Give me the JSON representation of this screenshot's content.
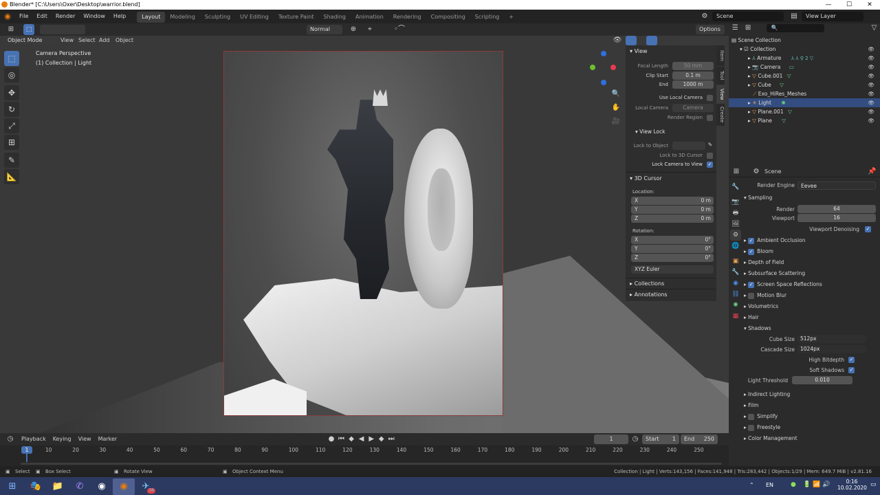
{
  "window": {
    "title": "Blender* [C:\\Users\\Oxer\\Desktop\\warrior.blend]",
    "minimize": "—",
    "maximize": "☐",
    "close": "✕"
  },
  "menubar": {
    "items": [
      "File",
      "Edit",
      "Render",
      "Window",
      "Help"
    ],
    "workspaces": [
      "Layout",
      "Modeling",
      "Sculpting",
      "UV Editing",
      "Texture Paint",
      "Shading",
      "Animation",
      "Rendering",
      "Compositing",
      "Scripting"
    ],
    "active_workspace": "Layout",
    "add_tab": "+",
    "scene": "Scene",
    "view_layer": "View Layer"
  },
  "toolheader": {
    "orientation": "Normal",
    "options": "Options"
  },
  "viewport_header": {
    "mode": "Object Mode",
    "menus": [
      "View",
      "Select",
      "Add",
      "Object"
    ]
  },
  "overlay": {
    "line1": "Camera Perspective",
    "line2": "(1) Collection | Light"
  },
  "npanel": {
    "tabs": [
      "Item",
      "Tool",
      "View",
      "Create"
    ],
    "view_header": "View",
    "focal_length_label": "Focal Length",
    "focal_length": "50 mm",
    "clip_start_label": "Clip Start",
    "clip_start": "0.1 m",
    "end_label": "End",
    "end": "1000 m",
    "use_local_camera": "Use Local Camera",
    "local_camera_label": "Local Camera",
    "local_camera": "Camera",
    "render_region": "Render Region",
    "view_lock_header": "View Lock",
    "lock_to_object": "Lock to Object",
    "lock_3d_cursor": "Lock to 3D Cursor",
    "lock_camera_to_view": "Lock Camera to View",
    "cursor_header": "3D Cursor",
    "location_label": "Location:",
    "loc": [
      {
        "axis": "X",
        "value": "0 m"
      },
      {
        "axis": "Y",
        "value": "0 m"
      },
      {
        "axis": "Z",
        "value": "0 m"
      }
    ],
    "rotation_label": "Rotation:",
    "rot": [
      {
        "axis": "X",
        "value": "0°"
      },
      {
        "axis": "Y",
        "value": "0°"
      },
      {
        "axis": "Z",
        "value": "0°"
      }
    ],
    "rot_mode": "XYZ Euler",
    "collections": "Collections",
    "annotations": "Annotations"
  },
  "outliner": {
    "root": "Scene Collection",
    "collection": "Collection",
    "items": [
      "Armature",
      "Camera",
      "Cube.001",
      "Cube",
      "Exo_HiRes_Meshes",
      "Light",
      "Plane.001",
      "Plane"
    ],
    "selected": "Light",
    "armature_count": "2"
  },
  "properties": {
    "context": "Scene",
    "render_engine_label": "Render Engine",
    "render_engine": "Eevee",
    "sampling": "Sampling",
    "render_label": "Render",
    "render_samples": "64",
    "viewport_label": "Viewport",
    "viewport_samples": "16",
    "viewport_denoising": "Viewport Denoising",
    "panels": [
      {
        "label": "Ambient Occlusion",
        "check": true
      },
      {
        "label": "Bloom",
        "check": true
      },
      {
        "label": "Depth of Field",
        "check": null
      },
      {
        "label": "Subsurface Scattering",
        "check": null
      },
      {
        "label": "Screen Space Reflections",
        "check": true
      },
      {
        "label": "Motion Blur",
        "check": false
      },
      {
        "label": "Volumetrics",
        "check": null
      },
      {
        "label": "Hair",
        "check": null
      }
    ],
    "shadows": "Shadows",
    "cube_size_label": "Cube Size",
    "cube_size": "512px",
    "cascade_size_label": "Cascade Size",
    "cascade_size": "1024px",
    "high_bitdepth": "High Bitdepth",
    "soft_shadows": "Soft Shadows",
    "light_threshold_label": "Light Threshold",
    "light_threshold": "0.010",
    "panels2": [
      {
        "label": "Indirect Lighting",
        "check": null
      },
      {
        "label": "Film",
        "check": null
      },
      {
        "label": "Simplify",
        "check": false
      },
      {
        "label": "Freestyle",
        "check": false
      },
      {
        "label": "Color Management",
        "check": null
      }
    ]
  },
  "timeline": {
    "menus": [
      "Playback",
      "Keying",
      "View",
      "Marker"
    ],
    "current_frame": "1",
    "start_label": "Start",
    "start": "1",
    "end_label": "End",
    "end": "250",
    "ticks": [
      "10",
      "20",
      "30",
      "40",
      "50",
      "60",
      "70",
      "80",
      "90",
      "100",
      "110",
      "120",
      "130",
      "140",
      "150",
      "160",
      "170",
      "180",
      "190",
      "200",
      "210",
      "220",
      "230",
      "240",
      "250"
    ],
    "frame_marker": "1"
  },
  "statusbar": {
    "select": "Select",
    "box_select": "Box Select",
    "rotate_view": "Rotate View",
    "context_menu": "Object Context Menu",
    "stats": "Collection | Light | Verts:143,156 | Faces:141,948 | Tris:283,442 | Objects:1/29 | Mem: 649.7 MiB | v2.81.16"
  },
  "taskbar": {
    "lang": "EN",
    "time": "0:16",
    "date": "10.02.2020",
    "badge": "38"
  }
}
